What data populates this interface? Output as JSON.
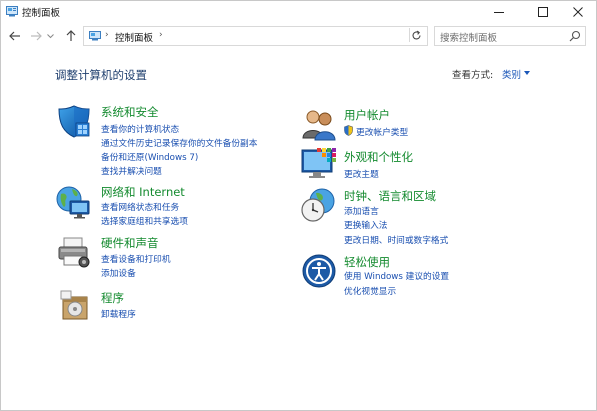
{
  "window": {
    "title": "控制面板"
  },
  "address": {
    "breadcrumb": "控制面板",
    "search_placeholder": "搜索控制面板"
  },
  "header": {
    "title": "调整计算机的设置",
    "view_by_label": "查看方式:",
    "view_by_value": "类别"
  },
  "categories": {
    "system": {
      "title": "系统和安全",
      "links": [
        "查看你的计算机状态",
        "通过文件历史记录保存你的文件备份副本",
        "备份和还原(Windows 7)",
        "查找并解决问题"
      ]
    },
    "network": {
      "title": "网络和 Internet",
      "links": [
        "查看网络状态和任务",
        "选择家庭组和共享选项"
      ]
    },
    "hardware": {
      "title": "硬件和声音",
      "links": [
        "查看设备和打印机",
        "添加设备"
      ]
    },
    "programs": {
      "title": "程序",
      "links": [
        "卸载程序"
      ]
    },
    "users": {
      "title": "用户帐户",
      "links": [
        "更改帐户类型"
      ]
    },
    "appearance": {
      "title": "外观和个性化",
      "links": [
        "更改主题"
      ]
    },
    "clock": {
      "title": "时钟、语言和区域",
      "links": [
        "添加语言",
        "更换输入法",
        "更改日期、时间或数字格式"
      ]
    },
    "ease": {
      "title": "轻松使用",
      "links": [
        "使用 Windows 建议的设置",
        "优化视觉显示"
      ]
    }
  },
  "colors": {
    "category_title": "#138a2e",
    "link": "#1a4fb0",
    "page_title": "#1f3f6e"
  }
}
